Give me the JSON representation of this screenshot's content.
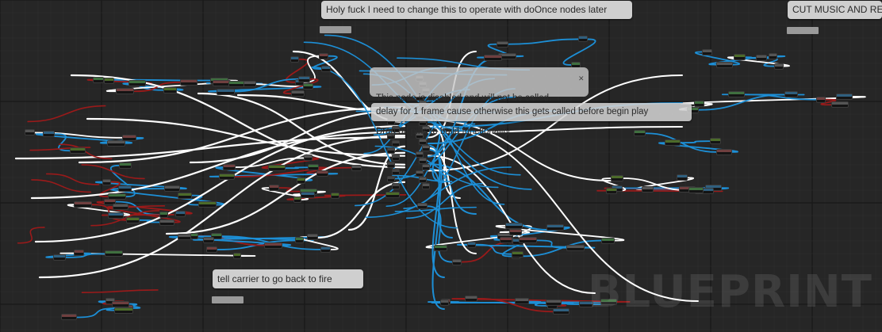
{
  "comments": {
    "top_comment": "Holy fuck I need to change this to operate with doOnce nodes later",
    "right_comment": "CUT MUSIC AND RE",
    "delay_comment": "delay for 1 frame cause otherwise this gets called before begin play",
    "fire_comment": "tell carrier to go back to fire"
  },
  "disabled_node": {
    "line1": "This node is disabled and will not be called.",
    "line2": "Drag off pins to build functionality."
  },
  "watermark": "BLUEPRINT",
  "colors": {
    "background": "#262626",
    "exec_wire": "#ffffff",
    "blue_wire": "#1d8fd6",
    "red_wire": "#9a1a1a",
    "node_body": "#141414",
    "comment_bg": "#cfcfcf"
  }
}
